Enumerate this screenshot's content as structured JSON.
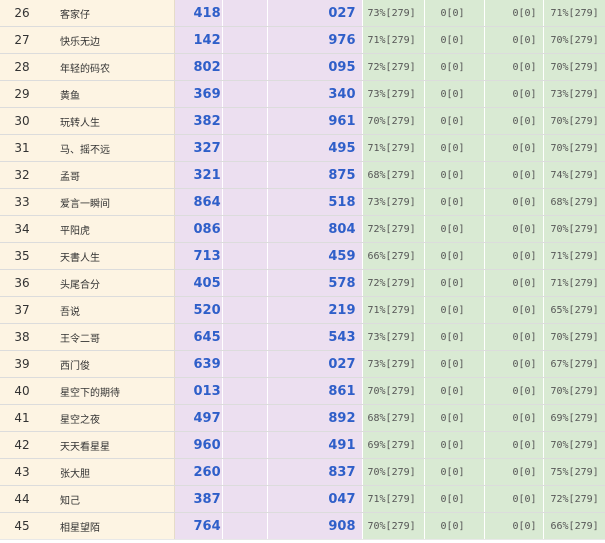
{
  "rows": [
    {
      "rank": "26",
      "name": "客家仔",
      "n1": "418",
      "n2": "027",
      "p1": "73%[279]",
      "z1": "0[0]",
      "z2": "0[0]",
      "p2": "71%[279]"
    },
    {
      "rank": "27",
      "name": "快乐无边",
      "n1": "142",
      "n2": "976",
      "p1": "71%[279]",
      "z1": "0[0]",
      "z2": "0[0]",
      "p2": "70%[279]"
    },
    {
      "rank": "28",
      "name": "年轻的码农",
      "n1": "802",
      "n2": "095",
      "p1": "72%[279]",
      "z1": "0[0]",
      "z2": "0[0]",
      "p2": "70%[279]"
    },
    {
      "rank": "29",
      "name": "黄鱼",
      "n1": "369",
      "n2": "340",
      "p1": "73%[279]",
      "z1": "0[0]",
      "z2": "0[0]",
      "p2": "73%[279]"
    },
    {
      "rank": "30",
      "name": "玩转人生",
      "n1": "382",
      "n2": "961",
      "p1": "70%[279]",
      "z1": "0[0]",
      "z2": "0[0]",
      "p2": "70%[279]"
    },
    {
      "rank": "31",
      "name": "马、摇不远",
      "n1": "327",
      "n2": "495",
      "p1": "71%[279]",
      "z1": "0[0]",
      "z2": "0[0]",
      "p2": "70%[279]"
    },
    {
      "rank": "32",
      "name": "孟哥",
      "n1": "321",
      "n2": "875",
      "p1": "68%[279]",
      "z1": "0[0]",
      "z2": "0[0]",
      "p2": "74%[279]"
    },
    {
      "rank": "33",
      "name": "爱言一瞬间",
      "n1": "864",
      "n2": "518",
      "p1": "73%[279]",
      "z1": "0[0]",
      "z2": "0[0]",
      "p2": "68%[279]"
    },
    {
      "rank": "34",
      "name": "平阳虎",
      "n1": "086",
      "n2": "804",
      "p1": "72%[279]",
      "z1": "0[0]",
      "z2": "0[0]",
      "p2": "70%[279]"
    },
    {
      "rank": "35",
      "name": "天書人生",
      "n1": "713",
      "n2": "459",
      "p1": "66%[279]",
      "z1": "0[0]",
      "z2": "0[0]",
      "p2": "71%[279]"
    },
    {
      "rank": "36",
      "name": "头尾合分",
      "n1": "405",
      "n2": "578",
      "p1": "72%[279]",
      "z1": "0[0]",
      "z2": "0[0]",
      "p2": "71%[279]"
    },
    {
      "rank": "37",
      "name": "吾说",
      "n1": "520",
      "n2": "219",
      "p1": "71%[279]",
      "z1": "0[0]",
      "z2": "0[0]",
      "p2": "65%[279]"
    },
    {
      "rank": "38",
      "name": "王令二哥",
      "n1": "645",
      "n2": "543",
      "p1": "73%[279]",
      "z1": "0[0]",
      "z2": "0[0]",
      "p2": "70%[279]"
    },
    {
      "rank": "39",
      "name": "西门俊",
      "n1": "639",
      "n2": "027",
      "p1": "73%[279]",
      "z1": "0[0]",
      "z2": "0[0]",
      "p2": "67%[279]"
    },
    {
      "rank": "40",
      "name": "星空下的期待",
      "n1": "013",
      "n2": "861",
      "p1": "70%[279]",
      "z1": "0[0]",
      "z2": "0[0]",
      "p2": "70%[279]"
    },
    {
      "rank": "41",
      "name": "星空之夜",
      "n1": "497",
      "n2": "892",
      "p1": "68%[279]",
      "z1": "0[0]",
      "z2": "0[0]",
      "p2": "69%[279]"
    },
    {
      "rank": "42",
      "name": "天天看星星",
      "n1": "960",
      "n2": "491",
      "p1": "69%[279]",
      "z1": "0[0]",
      "z2": "0[0]",
      "p2": "70%[279]"
    },
    {
      "rank": "43",
      "name": "张大胆",
      "n1": "260",
      "n2": "837",
      "p1": "70%[279]",
      "z1": "0[0]",
      "z2": "0[0]",
      "p2": "75%[279]"
    },
    {
      "rank": "44",
      "name": "知己",
      "n1": "387",
      "n2": "047",
      "p1": "71%[279]",
      "z1": "0[0]",
      "z2": "0[0]",
      "p2": "72%[279]"
    },
    {
      "rank": "45",
      "name": "相星望陌",
      "n1": "764",
      "n2": "908",
      "p1": "70%[279]",
      "z1": "0[0]",
      "z2": "0[0]",
      "p2": "66%[279]"
    }
  ]
}
